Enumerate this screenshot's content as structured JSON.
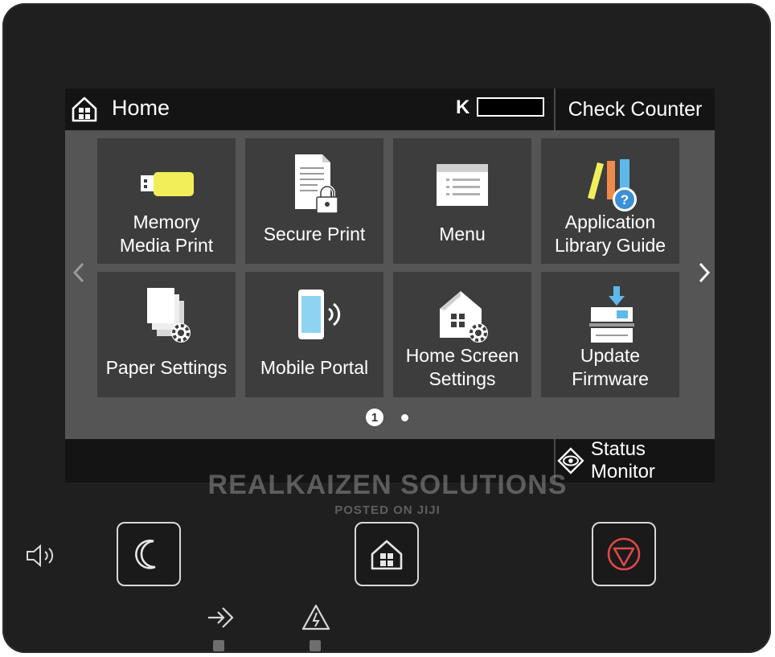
{
  "header": {
    "title": "Home",
    "toner_label": "K",
    "check_counter_label": "Check Counter"
  },
  "tiles": [
    {
      "label": "Memory\nMedia Print",
      "icon": "usb-drive-icon"
    },
    {
      "label": "Secure Print",
      "icon": "secure-document-icon"
    },
    {
      "label": "Menu",
      "icon": "menu-list-icon"
    },
    {
      "label": "Application\nLibrary Guide",
      "icon": "library-guide-icon"
    },
    {
      "label": "Paper Settings",
      "icon": "paper-settings-icon"
    },
    {
      "label": "Mobile Portal",
      "icon": "mobile-portal-icon"
    },
    {
      "label": "Home Screen\nSettings",
      "icon": "home-settings-icon"
    },
    {
      "label": "Update\nFirmware",
      "icon": "firmware-update-icon"
    }
  ],
  "pagination": {
    "current": "1",
    "total_pages": 2
  },
  "footer": {
    "status_monitor_label": "Status Monitor"
  },
  "watermark": {
    "line1": "REALKAIZEN SOLUTIONS",
    "line2": "POSTED ON JIJI"
  },
  "hardware_buttons": [
    "energy-saver",
    "home",
    "stop"
  ],
  "colors": {
    "bezel": "#1f1f1f",
    "topbar": "#141414",
    "tile": "#3d3d3d",
    "usb_yellow": "#f2ee5a",
    "stop_red": "#e04848",
    "phone_blue": "#8fd3f2"
  }
}
